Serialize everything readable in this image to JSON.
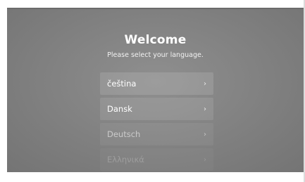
{
  "welcome": {
    "title": "Welcome",
    "subtitle": "Please select your language."
  },
  "languages": [
    {
      "label": "čeština",
      "chevron": "›"
    },
    {
      "label": "Dansk",
      "chevron": "›"
    },
    {
      "label": "Deutsch",
      "chevron": "›"
    },
    {
      "label": "Ελληνικά",
      "chevron": "›"
    }
  ]
}
